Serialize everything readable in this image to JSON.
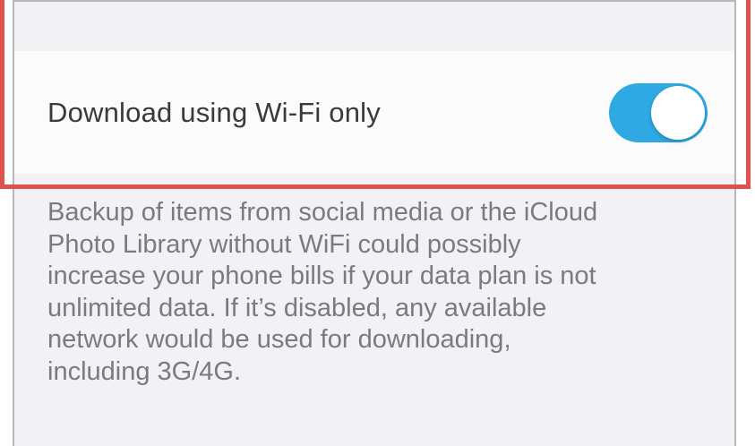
{
  "setting": {
    "label": "Download using Wi-Fi only",
    "toggle_state": "on",
    "toggle_color": "#2ea9e3"
  },
  "description": {
    "lines": [
      "Backup of items from social media or the iCloud",
      "Photo Library without WiFi could possibly",
      "increase your phone bills if your data plan is not",
      "unlimited data. If it’s disabled, any available",
      "network would be used for downloading,",
      "including 3G/4G."
    ]
  },
  "highlight": {
    "color": "#e0504d"
  }
}
